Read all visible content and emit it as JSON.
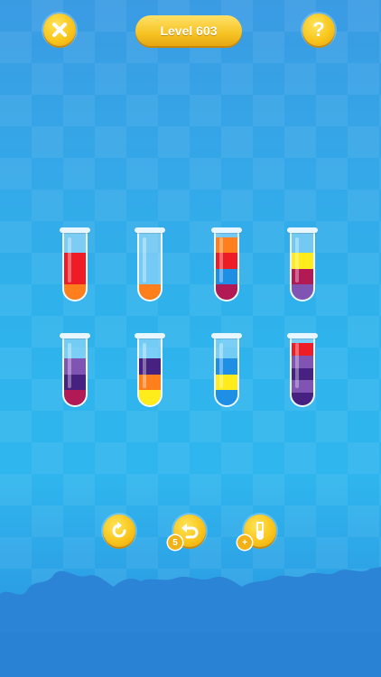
{
  "header": {
    "level_label": "Level 603"
  },
  "icons": {
    "close": "close-icon",
    "help": "question-icon",
    "restart": "restart-icon",
    "undo": "undo-icon",
    "add_tube": "add-tube-icon"
  },
  "toolbar": {
    "undo_count": "5",
    "add_tube_badge": "+"
  },
  "colors": {
    "red": "#ee1c24",
    "orange": "#ff7f1c",
    "blue": "#1f8fe6",
    "magenta": "#b21a56",
    "yellow": "#ffec1a",
    "purple": "#7f54b3",
    "dark_purple": "#46217f",
    "water": "#c6ecff",
    "gold": "#f6c323"
  },
  "tubes": [
    {
      "layers": [
        "orange",
        "red",
        "red"
      ],
      "capacity": 4
    },
    {
      "layers": [
        "orange"
      ],
      "capacity": 4
    },
    {
      "layers": [
        "magenta",
        "blue",
        "red",
        "orange"
      ],
      "capacity": 4
    },
    {
      "layers": [
        "purple",
        "magenta",
        "yellow"
      ],
      "capacity": 4
    },
    {
      "layers": [
        "magenta",
        "dark_purple",
        "purple"
      ],
      "capacity": 4
    },
    {
      "layers": [
        "yellow",
        "orange",
        "dark_purple"
      ],
      "capacity": 4
    },
    {
      "layers": [
        "blue",
        "yellow",
        "blue"
      ],
      "capacity": 4
    },
    {
      "layers": [
        "dark_purple",
        "purple",
        "dark_purple",
        "purple",
        "red"
      ],
      "capacity": 5
    }
  ]
}
